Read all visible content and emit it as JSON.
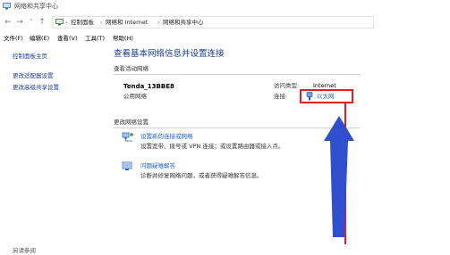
{
  "window": {
    "title": "网络和共享中心"
  },
  "nav": {
    "back_symbol": "←",
    "forward_symbol": "→",
    "recent_symbol": "˅",
    "up_symbol": "↑"
  },
  "breadcrumb": {
    "items": [
      "控制面板",
      "网络和 Internet",
      "网络和共享中心"
    ],
    "separator": "›"
  },
  "menu": {
    "items": [
      "文件(F)",
      "编辑(E)",
      "查看(V)",
      "工具(T)",
      "帮助(H)"
    ]
  },
  "sidebar": {
    "links": [
      "控制面板主页",
      "更改适配器设置",
      "更改高级共享设置"
    ],
    "see_also": "另请参阅"
  },
  "main": {
    "heading": "查看基本网络信息并设置连接",
    "active_section_title": "查看活动网络",
    "network": {
      "name": "Tenda_13BBE8",
      "type": "公用网络",
      "access_type_label": "访问类型:",
      "access_type_value": "Internet",
      "connections_label": "连接:",
      "connection_link": "以太网"
    },
    "change_section_title": "更改网络设置",
    "tasks": [
      {
        "link": "设置新的连接或网络",
        "desc": "设置宽带、拨号或 VPN 连接；或设置路由器或接入点。"
      },
      {
        "link": "问题疑难解答",
        "desc": "诊断并修复网络问题，或者获得疑难解答信息。"
      }
    ]
  },
  "annotation": {
    "highlight_color": "#e02020",
    "arrow_color": "#2f4fcf"
  },
  "colors": {
    "link": "#1b5fd0",
    "heading": "#1a3d8f",
    "sidebar_link": "#1b3e9a"
  }
}
